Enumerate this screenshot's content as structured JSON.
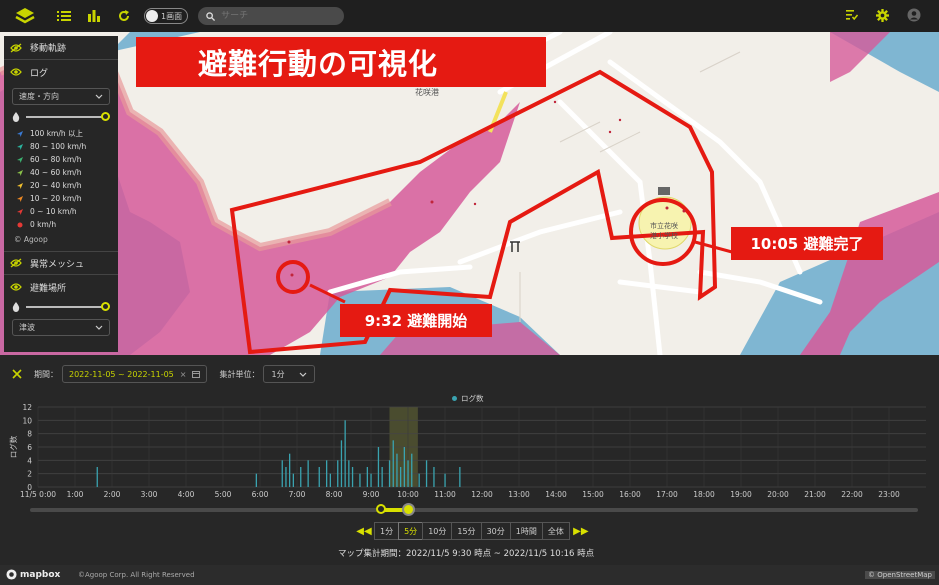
{
  "topbar": {
    "toggle_label": "1画面",
    "search_placeholder": "サーチ"
  },
  "map": {
    "title": "避難行動の可視化",
    "start_label": "9:32 避難開始",
    "end_label": "10:05 避難完了",
    "place_label": "花咲港",
    "school_label_1": "市立花咲",
    "school_label_2": "港小学校"
  },
  "panel": {
    "movement_trace": "移動軌跡",
    "log": "ログ",
    "log_select": "速度・方向",
    "speed_legend": [
      {
        "label": "100 km/h 以上",
        "color": "#3a7bd5"
      },
      {
        "label": "80 ~ 100 km/h",
        "color": "#2bb5a0"
      },
      {
        "label": "60 ~ 80 km/h",
        "color": "#3cb371"
      },
      {
        "label": "40 ~ 60 km/h",
        "color": "#8bc34a"
      },
      {
        "label": "20 ~ 40 km/h",
        "color": "#f2c12e"
      },
      {
        "label": "10 ~ 20 km/h",
        "color": "#f08a24"
      },
      {
        "label": "0 ~ 10 km/h",
        "color": "#e53935"
      },
      {
        "label": "0 km/h",
        "color": "#e53935"
      }
    ],
    "credit": "© Agoop",
    "anomaly_mesh": "異常メッシュ",
    "shelter": "避難場所",
    "shelter_select": "津波"
  },
  "bottom": {
    "period_label": "期間：",
    "date_range": "2022-11-05 ~ 2022-11-05",
    "unit_label": "集計単位：",
    "unit_value": "1分",
    "legend": "ログ数",
    "y_axis_label": "ログ数",
    "buttons": [
      "1分",
      "5分",
      "10分",
      "15分",
      "30分",
      "1時間",
      "全体"
    ],
    "active_button": "5分",
    "map_period": "マップ集計期間：2022/11/5 9:30 時点 ~ 2022/11/5 10:16 時点"
  },
  "chart_data": {
    "type": "bar",
    "title": "",
    "xlabel": "",
    "ylabel": "ログ数",
    "series": [
      {
        "name": "ログ数",
        "color": "#3aa3b0"
      }
    ],
    "ylim": [
      0,
      12
    ],
    "yticks": [
      0,
      2,
      4,
      6,
      8,
      10,
      12
    ],
    "xticks": [
      "11/5 0:00",
      "1:00",
      "2:00",
      "3:00",
      "4:00",
      "5:00",
      "6:00",
      "7:00",
      "8:00",
      "9:00",
      "10:00",
      "11:00",
      "12:00",
      "13:00",
      "14:00",
      "15:00",
      "16:00",
      "17:00",
      "18:00",
      "19:00",
      "20:00",
      "21:00",
      "22:00",
      "23:00"
    ],
    "highlight_range": [
      "9:30",
      "10:16"
    ],
    "points": [
      [
        1.6,
        3
      ],
      [
        5.9,
        2
      ],
      [
        6.6,
        4
      ],
      [
        6.7,
        3
      ],
      [
        6.8,
        5
      ],
      [
        6.9,
        2
      ],
      [
        7.1,
        3
      ],
      [
        7.3,
        4
      ],
      [
        7.6,
        3
      ],
      [
        7.8,
        4
      ],
      [
        7.9,
        2
      ],
      [
        8.1,
        4
      ],
      [
        8.2,
        7
      ],
      [
        8.3,
        10
      ],
      [
        8.4,
        4
      ],
      [
        8.5,
        3
      ],
      [
        8.7,
        2
      ],
      [
        8.9,
        3
      ],
      [
        9.0,
        2
      ],
      [
        9.2,
        6
      ],
      [
        9.3,
        3
      ],
      [
        9.5,
        4
      ],
      [
        9.6,
        7
      ],
      [
        9.7,
        5
      ],
      [
        9.8,
        3
      ],
      [
        9.9,
        6
      ],
      [
        10.0,
        4
      ],
      [
        10.1,
        5
      ],
      [
        10.3,
        2
      ],
      [
        10.5,
        4
      ],
      [
        10.7,
        3
      ],
      [
        11.0,
        2
      ],
      [
        11.4,
        3
      ]
    ]
  },
  "footer": {
    "mapbox": "mapbox",
    "copyright": "©Agoop Corp. All Right Reserved",
    "osm": "© OpenStreetMap"
  }
}
